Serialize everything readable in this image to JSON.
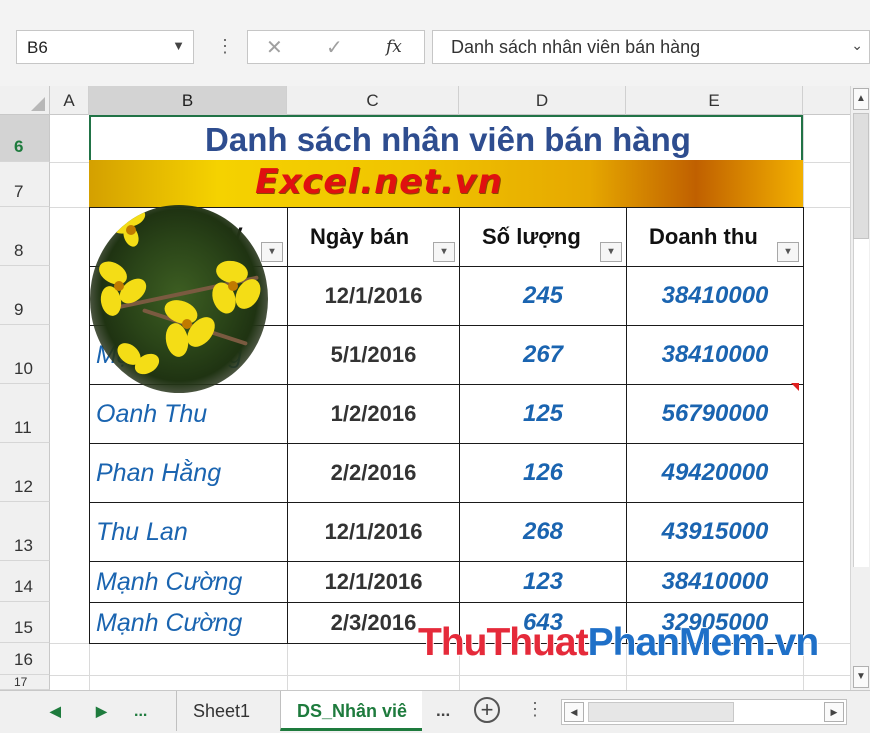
{
  "formula_bar": {
    "name_box": "B6",
    "name_box_arrow": "▼",
    "separator_dots": "⋮",
    "cancel_icon": "✕",
    "enter_icon": "✓",
    "fx_label": "fx",
    "formula_text": "Danh sách nhân viên bán hàng",
    "expand_icon": "⌄"
  },
  "columns": [
    "A",
    "B",
    "C",
    "D",
    "E"
  ],
  "selected_column": "B",
  "rows": [
    "6",
    "7",
    "8",
    "9",
    "10",
    "11",
    "12",
    "13",
    "14",
    "15",
    "16",
    "17"
  ],
  "selected_row": "6",
  "sheet": {
    "title": "Danh sách nhân viên bán hàng",
    "banner": "Excel.net.vn",
    "headers": [
      "Họ tên NV",
      "Ngày bán",
      "Số lượng",
      "Doanh thu"
    ],
    "visible_headers": [
      "V",
      "Ngày bán",
      "Số lượng",
      "Doanh thu"
    ],
    "filter_icon": "▾",
    "records": [
      {
        "name": "",
        "date": "12/1/2016",
        "qty": "245",
        "revenue": "38410000"
      },
      {
        "name": "Mạnh Cường",
        "date": "5/1/2016",
        "qty": "267",
        "revenue": "38410000"
      },
      {
        "name": "Oanh Thu",
        "date": "1/2/2016",
        "qty": "125",
        "revenue": "56790000"
      },
      {
        "name": "Phan Hằng",
        "date": "2/2/2016",
        "qty": "126",
        "revenue": "49420000"
      },
      {
        "name": "Thu Lan",
        "date": "12/1/2016",
        "qty": "268",
        "revenue": "43915000"
      },
      {
        "name": "Mạnh Cường",
        "date": "12/1/2016",
        "qty": "123",
        "revenue": "38410000"
      },
      {
        "name": "Mạnh Cường",
        "date": "2/3/2016",
        "qty": "643",
        "revenue": "32905000"
      }
    ]
  },
  "watermark": {
    "part1": "ThuThuat",
    "part2": "PhanMem",
    "part3": ".vn"
  },
  "tabs": {
    "prev_icon": "◀",
    "next_icon": "▶",
    "more": "...",
    "items": [
      "Sheet1",
      "DS_Nhân viê"
    ],
    "active_index": 1,
    "overflow": "...",
    "add_icon": "+",
    "menu_dots": "⋮"
  },
  "scrollbar": {
    "up_icon": "▲",
    "down_icon": "▼",
    "left_icon": "◀",
    "right_icon": "▶"
  }
}
